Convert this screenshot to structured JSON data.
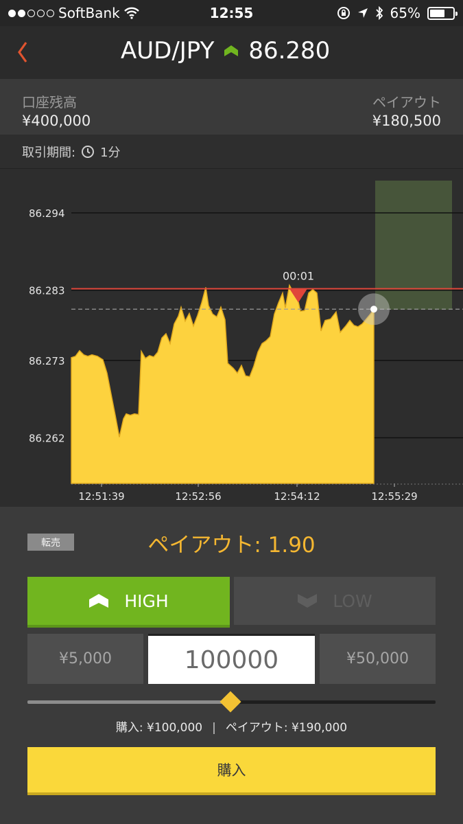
{
  "status_bar": {
    "carrier": "SoftBank",
    "time": "12:55",
    "battery": "65%",
    "battery_level": 0.65,
    "signal_bars_filled": 2,
    "signal_bars_total": 5
  },
  "header": {
    "pair": "AUD/JPY",
    "price": "86.280",
    "trend": "up",
    "trend_color": "#71b51f"
  },
  "account": {
    "balance_label": "口座残高",
    "balance_value": "¥400,000",
    "payout_label": "ペイアウト",
    "payout_value": "¥180,500"
  },
  "period": {
    "label": "取引期間:",
    "value": "1分"
  },
  "chart_data": {
    "type": "area",
    "y_ticks": [
      "86.294",
      "86.283",
      "86.273",
      "86.262"
    ],
    "x_ticks": [
      "12:51:39",
      "12:52:56",
      "12:54:12",
      "12:55:29"
    ],
    "ylim": [
      86.2555,
      86.2985
    ],
    "strike_price": 86.2832,
    "current_price": 86.2803,
    "countdown": "00:01",
    "colors": {
      "area": "#fdd23e",
      "strike": "#e0463a",
      "expiry_zone": "#47553a"
    },
    "series": [
      {
        "x": "12:51:39",
        "values": [
          86.2734,
          86.2736,
          86.2742,
          86.2738,
          86.2736,
          86.2738,
          86.2731,
          86.2734,
          86.2732,
          86.2735,
          86.2731,
          86.2733
        ]
      },
      {
        "x": "12:52:00",
        "values": [
          86.271,
          86.2683,
          86.2652,
          86.262,
          86.2648,
          86.266,
          86.2654,
          86.2658,
          86.2656,
          86.2653,
          86.2735,
          86.2745,
          86.2742,
          86.2737
        ]
      }
    ],
    "points": [
      [
        0,
        86.2734
      ],
      [
        6,
        86.2736
      ],
      [
        12,
        86.2744
      ],
      [
        18,
        86.2738
      ],
      [
        24,
        86.2736
      ],
      [
        30,
        86.2738
      ],
      [
        38,
        86.2736
      ],
      [
        46,
        86.2731
      ],
      [
        52,
        86.2712
      ],
      [
        58,
        86.2682
      ],
      [
        64,
        86.2652
      ],
      [
        70,
        86.2621
      ],
      [
        76,
        86.2647
      ],
      [
        80,
        86.2654
      ],
      [
        86,
        86.2652
      ],
      [
        92,
        86.2654
      ],
      [
        98,
        86.2653
      ],
      [
        102,
        86.2743
      ],
      [
        108,
        86.2733
      ],
      [
        114,
        86.2737
      ],
      [
        120,
        86.2735
      ],
      [
        126,
        86.2742
      ],
      [
        132,
        86.2762
      ],
      [
        138,
        86.2768
      ],
      [
        144,
        86.2754
      ],
      [
        150,
        86.2782
      ],
      [
        156,
        86.2793
      ],
      [
        160,
        86.2806
      ],
      [
        166,
        86.2786
      ],
      [
        172,
        86.2797
      ],
      [
        178,
        86.2779
      ],
      [
        184,
        86.2794
      ],
      [
        190,
        86.2812
      ],
      [
        196,
        86.2834
      ],
      [
        200,
        86.2808
      ],
      [
        206,
        86.2796
      ],
      [
        212,
        86.2792
      ],
      [
        218,
        86.2806
      ],
      [
        224,
        86.2788
      ],
      [
        228,
        86.2726
      ],
      [
        236,
        86.2719
      ],
      [
        242,
        86.2712
      ],
      [
        248,
        86.2723
      ],
      [
        254,
        86.2708
      ],
      [
        260,
        86.2707
      ],
      [
        266,
        86.2722
      ],
      [
        272,
        86.2742
      ],
      [
        278,
        86.2754
      ],
      [
        284,
        86.2758
      ],
      [
        290,
        86.2764
      ],
      [
        296,
        86.2796
      ],
      [
        302,
        86.2812
      ],
      [
        308,
        86.2826
      ],
      [
        312,
        86.2805
      ],
      [
        318,
        86.2837
      ],
      [
        322,
        86.283
      ],
      [
        328,
        86.2827
      ],
      [
        334,
        86.28
      ],
      [
        340,
        86.2801
      ],
      [
        346,
        86.2826
      ],
      [
        352,
        86.2831
      ],
      [
        358,
        86.2826
      ],
      [
        364,
        86.2772
      ],
      [
        370,
        86.2787
      ],
      [
        378,
        86.2789
      ],
      [
        386,
        86.2799
      ],
      [
        392,
        86.277
      ],
      [
        400,
        86.2779
      ],
      [
        406,
        86.2787
      ],
      [
        412,
        86.278
      ],
      [
        418,
        86.2778
      ],
      [
        424,
        86.2782
      ],
      [
        430,
        86.2789
      ],
      [
        436,
        86.2796
      ],
      [
        441,
        86.2803
      ]
    ]
  },
  "trade": {
    "resale_label": "転売",
    "payout_rate": "ペイアウト: 1.90",
    "high_label": "HIGH",
    "low_label": "LOW",
    "amount_left": "¥5,000",
    "amount_value": "100000",
    "amount_right": "¥50,000",
    "slider_level": 0.5,
    "purchase_summary": "購入: ¥100,000",
    "payout_summary": "ペイアウト: ¥190,000",
    "buy_label": "購入"
  }
}
